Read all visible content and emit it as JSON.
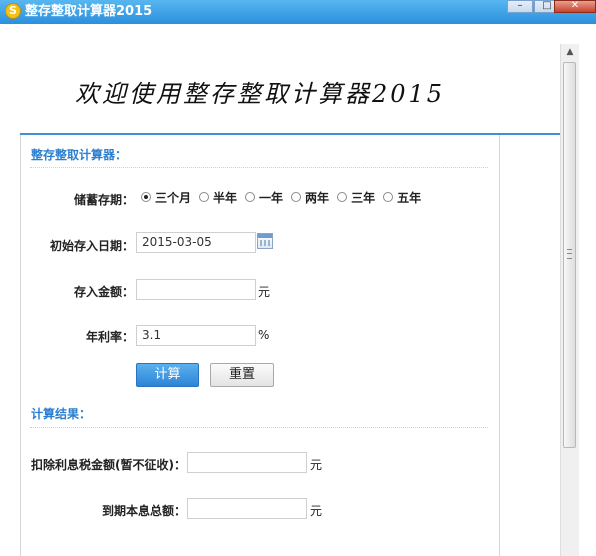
{
  "window": {
    "title": "整存整取计算器2015",
    "icon_glyph": "S",
    "controls": {
      "minimize": "–",
      "maximize": "□",
      "close": "✕"
    }
  },
  "banner": {
    "text": "欢迎使用整存整取计算器2015"
  },
  "calculator": {
    "section_title": "整存整取计算器：",
    "term": {
      "label": "储蓄存期：",
      "options": [
        "三个月",
        "半年",
        "一年",
        "两年",
        "三年",
        "五年"
      ],
      "selected_index": 0
    },
    "start_date": {
      "label": "初始存入日期：",
      "value": "2015-03-05"
    },
    "amount": {
      "label": "存入金额：",
      "value": "",
      "unit": "元"
    },
    "rate": {
      "label": "年利率：",
      "value": "3.1",
      "unit": "%"
    },
    "buttons": {
      "calculate": "计算",
      "reset": "重置"
    }
  },
  "results": {
    "section_title": "计算结果：",
    "after_tax_interest": {
      "label": "扣除利息税金额(暂不征收)：",
      "value": "",
      "unit": "元"
    },
    "total": {
      "label": "到期本息总额：",
      "value": "",
      "unit": "元"
    }
  },
  "colors": {
    "accent": "#2b7fd0",
    "titlebar": "#3a9de6",
    "primary_button": "#3a8fdc"
  }
}
